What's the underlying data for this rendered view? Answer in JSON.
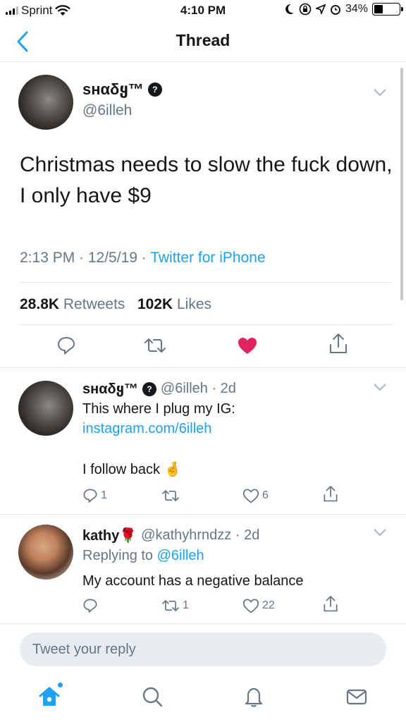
{
  "status_bar": {
    "carrier": "Sprint",
    "time": "4:10 PM",
    "battery_percent": "34%",
    "battery_level": 0.34
  },
  "nav": {
    "title": "Thread"
  },
  "main_tweet": {
    "name": "sʜαδყ™",
    "handle": "@6illeh",
    "text": "Christmas needs to slow the fuck down, I only have $9",
    "time": "2:13 PM · 12/5/19 · ",
    "source": "Twitter for iPhone",
    "retweets_count": "28.8K",
    "retweets_label": "Retweets",
    "likes_count": "102K",
    "likes_label": "Likes",
    "liked": true,
    "like_color": "#e0245e"
  },
  "replies": [
    {
      "name": "sʜαδყ™",
      "handle": "@6illeh · 2d",
      "line1": "This where I plug my IG:",
      "link": "instagram.com/6illeh",
      "line2": "I follow back 🤞",
      "reply_count": "1",
      "retweet_count": "",
      "like_count": "6"
    },
    {
      "name": "kathy🌹",
      "handle": "@kathyhrndzz · 2d",
      "replying_prefix": "Replying to ",
      "replying_to": "@6illeh",
      "text": "My account has a negative balance",
      "reply_count": "",
      "retweet_count": "1",
      "like_count": "22"
    }
  ],
  "composer": {
    "placeholder": "Tweet your reply"
  },
  "tabbar": [
    "home-icon",
    "search-icon",
    "notifications-icon",
    "messages-icon"
  ],
  "colors": {
    "accent": "#1da1f2",
    "text": "#14171a",
    "muted": "#657786"
  }
}
